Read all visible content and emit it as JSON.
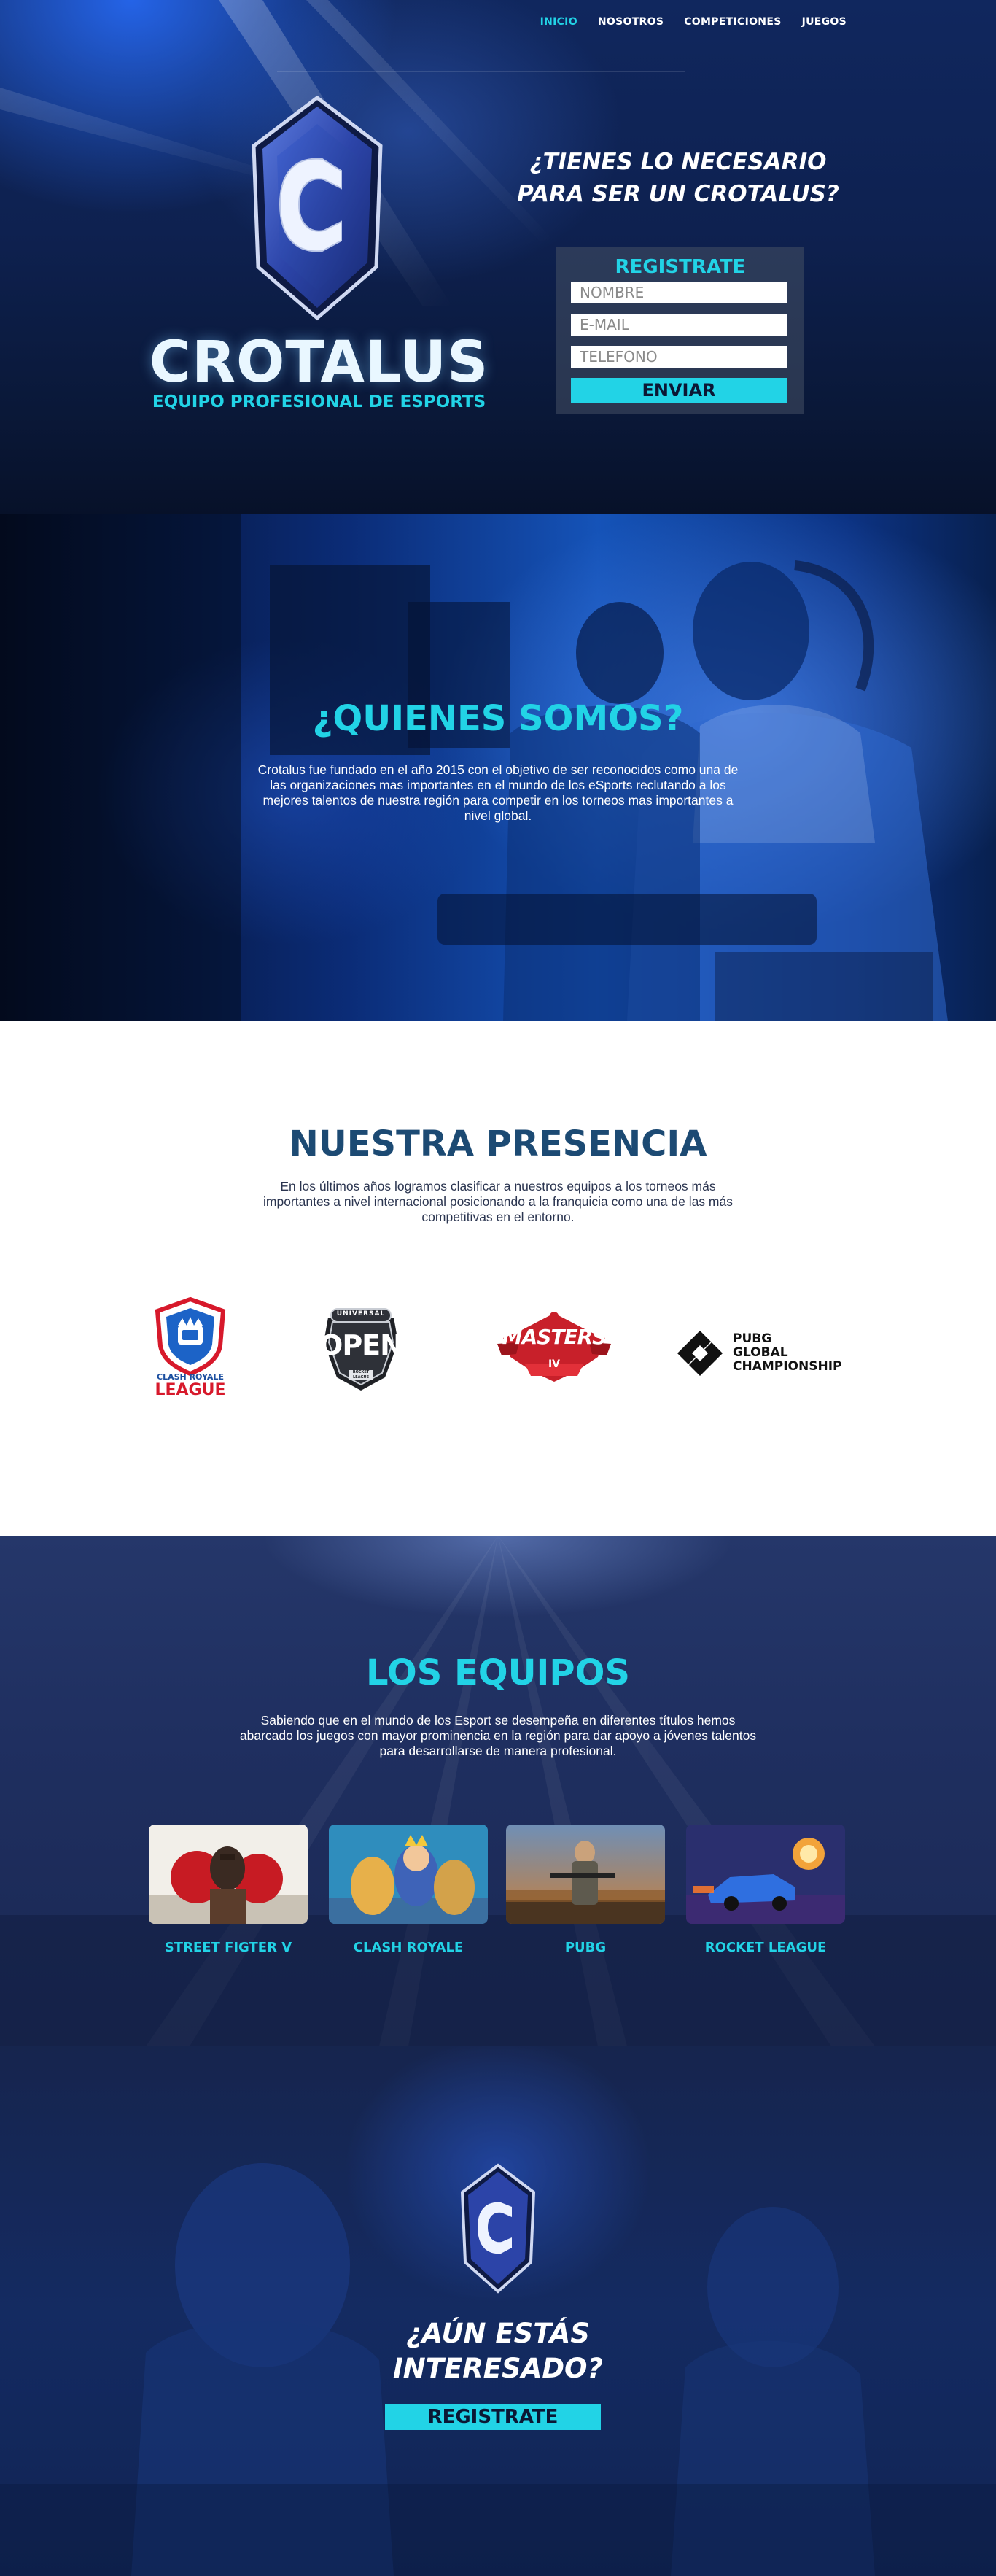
{
  "nav": {
    "items": [
      {
        "label": "INICIO",
        "active": true
      },
      {
        "label": "NOSOTROS",
        "active": false
      },
      {
        "label": "COMPETICIONES",
        "active": false
      },
      {
        "label": "JUEGOS",
        "active": false
      }
    ]
  },
  "hero": {
    "logo_letter": "C",
    "brand": "CROTALUS",
    "subtitle": "EQUIPO PROFESIONAL DE ESPORTS",
    "question_line1": "¿TIENES LO NECESARIO",
    "question_line2": "PARA SER UN CROTALUS?"
  },
  "register_form": {
    "title": "REGISTRATE",
    "name_placeholder": "NOMBRE",
    "email_placeholder": "E-MAIL",
    "phone_placeholder": "TELEFONO",
    "submit_label": "ENVIAR"
  },
  "about": {
    "title": "¿QUIENES SOMOS?",
    "text": "Crotalus  fue fundado en el año 2015 con el objetivo de ser reconocidos como una de las organizaciones mas importantes en el mundo de los eSports reclutando a los mejores talentos de nuestra región para competir en los torneos mas importantes a nivel global."
  },
  "presence": {
    "title": "NUESTRA PRESENCIA",
    "text": "En los últimos años logramos clasificar a nuestros equipos a los torneos más importantes a nivel internacional posicionando a la franquicia como una de las más competitivas en el entorno.",
    "logos": [
      {
        "name": "clash-royale-league",
        "line1": "CLASH ROYALE",
        "line2": "LEAGUE"
      },
      {
        "name": "universal-open",
        "line1": "UNIVERSAL",
        "line2": "OPEN",
        "line3": "ROCKET LEAGUE"
      },
      {
        "name": "masters-iv",
        "line1": "MASTERS",
        "line2": "IV"
      },
      {
        "name": "pubg-global-championship",
        "line1": "PUBG",
        "line2": "GLOBAL",
        "line3": "CHAMPIONSHIP"
      }
    ]
  },
  "teams": {
    "title": "LOS EQUIPOS",
    "text": "Sabiendo que en el mundo de los Esport se desempeña en diferentes títulos hemos abarcado los juegos con mayor prominencia en la región para dar apoyo a jóvenes talentos para desarrollarse de manera profesional.",
    "items": [
      {
        "label": "STREET FIGTER V"
      },
      {
        "label": "CLASH ROYALE"
      },
      {
        "label": "PUBG"
      },
      {
        "label": "ROCKET LEAGUE"
      }
    ]
  },
  "cta": {
    "title_line1": "¿AÚN ESTÁS",
    "title_line2": "INTERESADO?",
    "button_label": "REGISTRATE"
  },
  "colors": {
    "accent": "#22d3e6",
    "navy": "#0b1734",
    "presence_title": "#1c4a73"
  }
}
